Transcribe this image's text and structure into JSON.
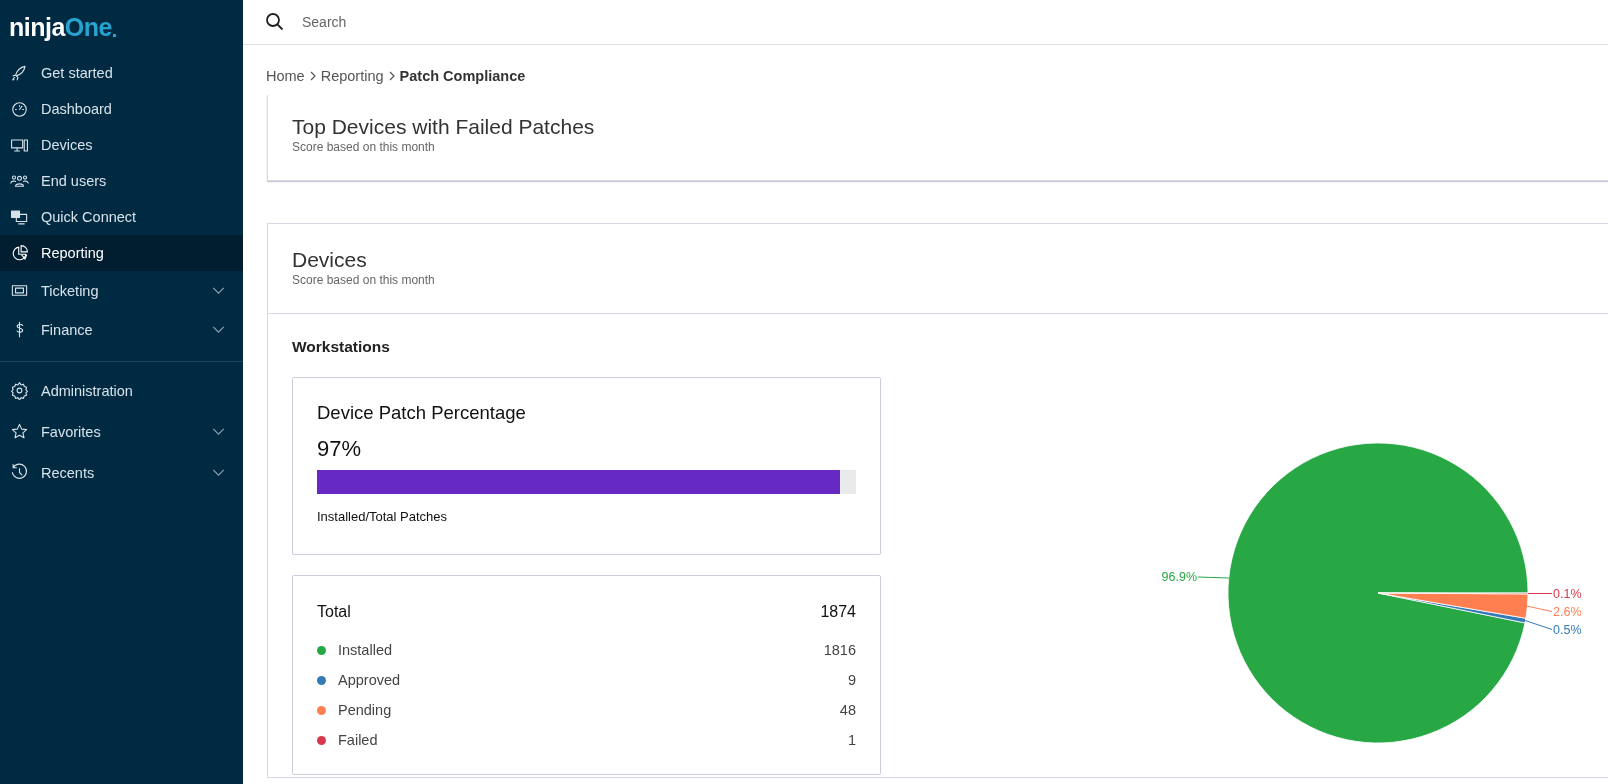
{
  "logo": {
    "text": "ninja",
    "accent": "One"
  },
  "sidebar": {
    "items": [
      {
        "label": "Get started",
        "kind": "link",
        "selected": false
      },
      {
        "label": "Dashboard",
        "kind": "link",
        "selected": false
      },
      {
        "label": "Devices",
        "kind": "link",
        "selected": false
      },
      {
        "label": "End users",
        "kind": "link",
        "selected": false
      },
      {
        "label": "Quick Connect",
        "kind": "link",
        "selected": false
      },
      {
        "label": "Reporting",
        "kind": "link",
        "selected": true
      },
      {
        "label": "Ticketing",
        "kind": "group",
        "selected": false
      },
      {
        "label": "Finance",
        "kind": "group",
        "selected": false
      }
    ],
    "bottom_items": [
      {
        "label": "Administration",
        "kind": "link",
        "selected": false
      },
      {
        "label": "Favorites",
        "kind": "group",
        "selected": false
      },
      {
        "label": "Recents",
        "kind": "group",
        "selected": false
      }
    ]
  },
  "search": {
    "placeholder": "Search"
  },
  "breadcrumb": [
    "Home",
    "Reporting",
    "Patch Compliance"
  ],
  "top_devices": {
    "title": "Top Devices with Failed Patches",
    "subtitle": "Score based on this month"
  },
  "devices": {
    "title": "Devices",
    "subtitle": "Score based on this month",
    "section": "Workstations",
    "patch_percentage": {
      "title": "Device Patch Percentage",
      "value": "97%",
      "level": 0.97,
      "caption": "Installed/Total Patches"
    },
    "totals": {
      "label": "Total",
      "value": "1874",
      "items": [
        {
          "label": "Installed",
          "value": "1816",
          "color": "#28a745"
        },
        {
          "label": "Approved",
          "value": "9",
          "color": "#337ab7"
        },
        {
          "label": "Pending",
          "value": "48",
          "color": "#ff7f50"
        },
        {
          "label": "Failed",
          "value": "1",
          "color": "#d9374b"
        }
      ]
    },
    "chart_data": {
      "type": "pie",
      "values": [
        96.9,
        0.5,
        2.6,
        0.1
      ],
      "value_labels": [
        "96.9%",
        "0.5%",
        "2.6%",
        "0.1%"
      ]
    }
  }
}
